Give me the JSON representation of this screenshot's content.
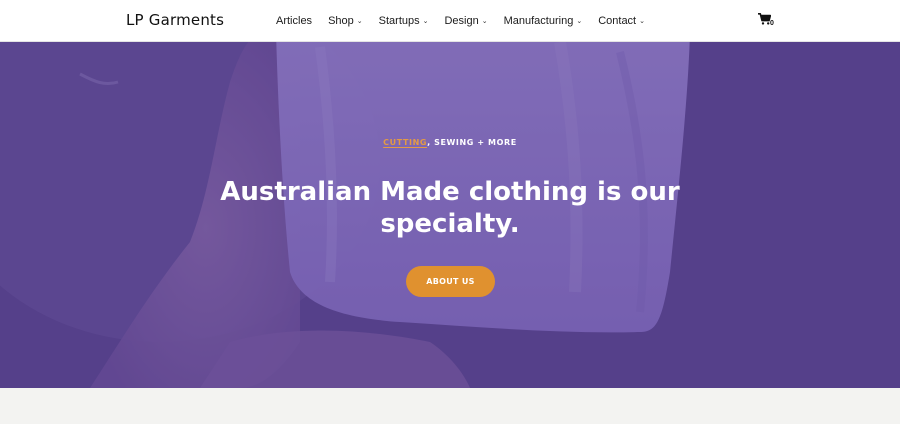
{
  "header": {
    "logo": "LP Garments",
    "nav": [
      {
        "label": "Articles",
        "dropdown": false
      },
      {
        "label": "Shop",
        "dropdown": true
      },
      {
        "label": "Startups",
        "dropdown": true
      },
      {
        "label": "Design",
        "dropdown": true
      },
      {
        "label": "Manufacturing",
        "dropdown": true
      },
      {
        "label": "Contact",
        "dropdown": true
      }
    ],
    "cart_count": "0",
    "cart_icon": "shopping-cart-icon",
    "chevron_icon": "chevron-down-icon"
  },
  "hero": {
    "eyebrow_accent": "CUTTING",
    "eyebrow_rest": ", SEWING + MORE",
    "headline": "Australian Made clothing is our specialty.",
    "cta_label": "ABOUT US"
  },
  "colors": {
    "hero_overlay": "#544186",
    "accent": "#e39a45",
    "cta": "#e0912f",
    "header_bg": "#ffffff"
  }
}
